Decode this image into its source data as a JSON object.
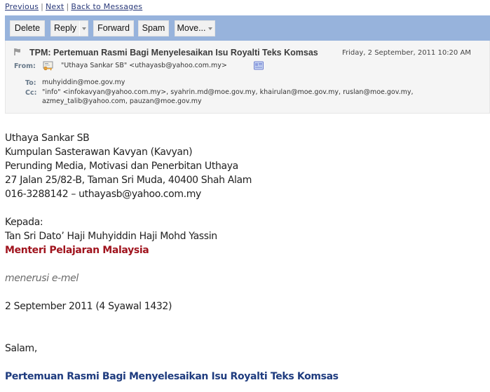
{
  "nav": {
    "previous": "Previous",
    "separator": "|",
    "next": "Next",
    "back": "Back to Messages"
  },
  "toolbar": {
    "delete": "Delete",
    "reply": "Reply",
    "forward": "Forward",
    "spam": "Spam",
    "move": "Move...",
    "color": "#97b3dc"
  },
  "header": {
    "subject": "TPM: Pertemuan Rasmi Bagi Menyelesaikan Isu Royalti Teks Komsas",
    "date": "Friday, 2 September, 2011 10:20 AM",
    "from_label": "From:",
    "from": "\"Uthaya Sankar SB\" <uthayasb@yahoo.com.my>",
    "to_label": "To:",
    "to": "muhyiddin@moe.gov.my",
    "cc_label": "Cc:",
    "cc_line1": "\"info\" <infokavyan@yahoo.com.my>, syahrin.md@moe.gov.my, khairulan@moe.gov.my, ruslan@moe.gov.my,",
    "cc_line2": "azmey_talib@yahoo.com, pauzan@moe.gov.my",
    "icons": {
      "flag": "flag-icon",
      "contact": "contact-key-icon",
      "vcard": "add-contact-card-icon"
    }
  },
  "body": {
    "sender_lines": [
      "Uthaya Sankar SB",
      "Kumpulan Sasterawan Kavyan (Kavyan)",
      "Perunding Media, Motivasi dan Penerbitan Uthaya",
      "27 Jalan 25/82-B, Taman Sri Muda, 40400 Shah Alam",
      "016-3288142 – uthayasb@yahoo.com.my"
    ],
    "to_heading": "Kepada:",
    "recipient_name": "Tan Sri Dato’ Haji Muhyiddin Haji Mohd Yassin",
    "recipient_title": "Menteri Pelajaran Malaysia",
    "via": "menerusi e-mel",
    "date": "2 September 2011 (4 Syawal 1432)",
    "greeting": "Salam,",
    "title": "Pertemuan Rasmi Bagi Menyelesaikan Isu Royalti Teks Komsas",
    "colors": {
      "recipient_title": "#a0141e",
      "title": "#1f3c7f"
    }
  }
}
